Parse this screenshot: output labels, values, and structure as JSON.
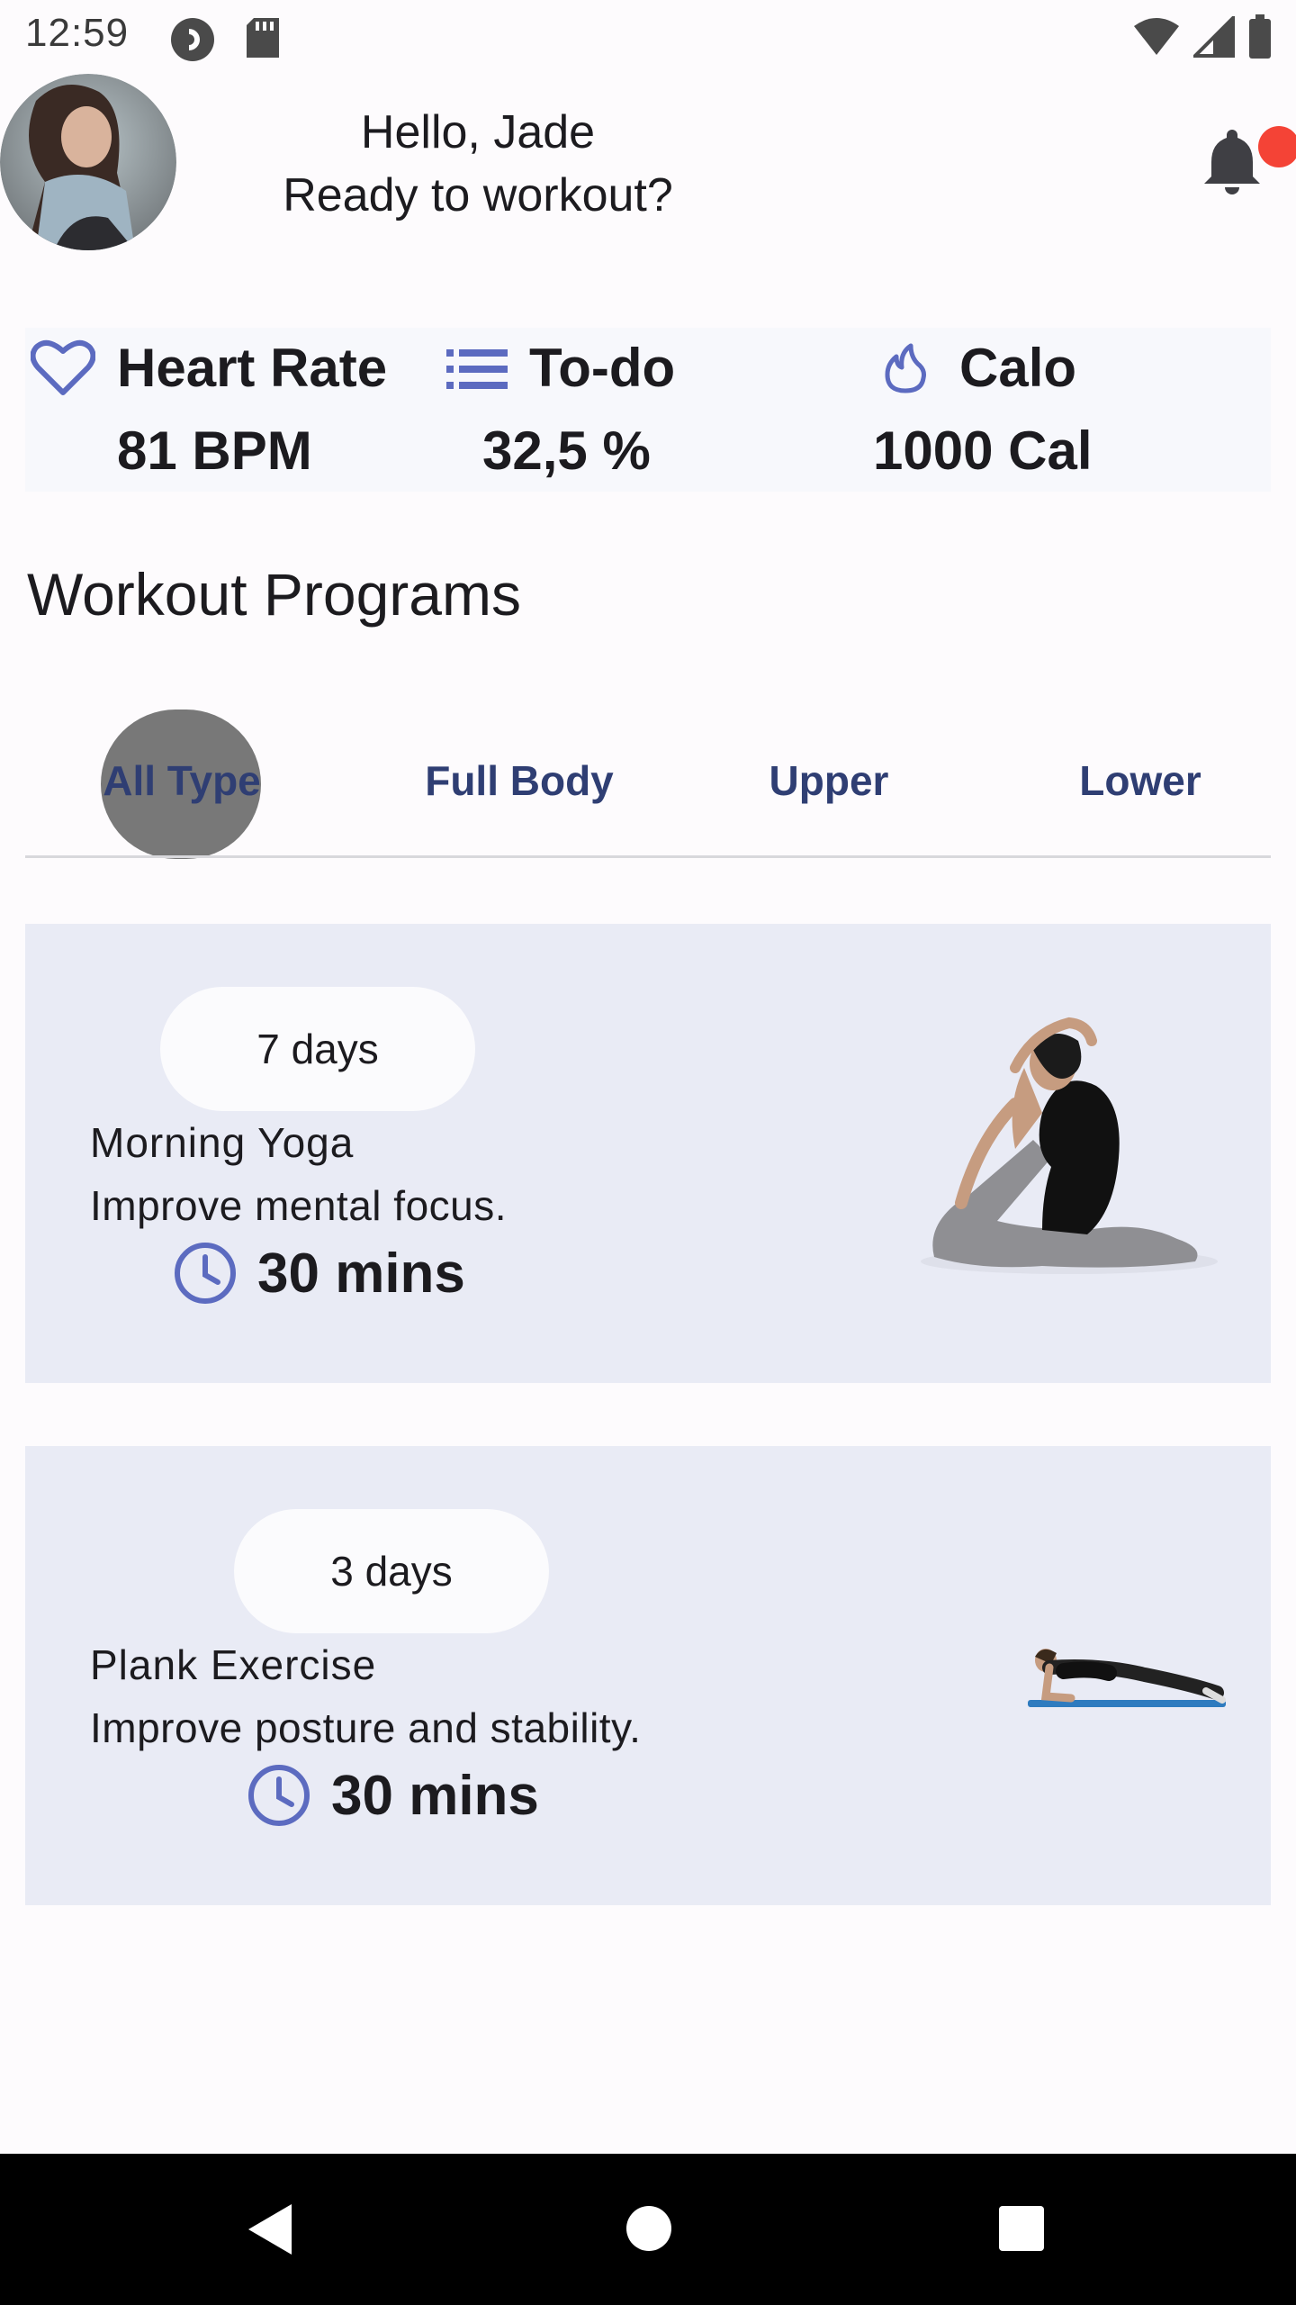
{
  "status_bar": {
    "time": "12:59",
    "left_icons": [
      "pocket-casts-icon",
      "sd-card-icon"
    ],
    "right_icons": [
      "wifi-icon",
      "signal-icon",
      "battery-icon"
    ]
  },
  "header": {
    "greeting": "Hello, Jade",
    "subtitle": "Ready to workout?",
    "avatar_icon": "avatar",
    "bell_icon": "bell-icon",
    "notification_color": "#f44336"
  },
  "stats": [
    {
      "icon": "heart-icon",
      "label": "Heart Rate",
      "value": "81 BPM"
    },
    {
      "icon": "list-icon",
      "label": "To-do",
      "value": "32,5 %"
    },
    {
      "icon": "flame-icon",
      "label": "Calo",
      "value": "1000 Cal"
    }
  ],
  "section_title": "Workout Programs",
  "tabs": [
    {
      "label": "All Type",
      "selected": true
    },
    {
      "label": "Full Body",
      "selected": false
    },
    {
      "label": "Upper",
      "selected": false
    },
    {
      "label": "Lower",
      "selected": false
    }
  ],
  "programs": [
    {
      "days": "7 days",
      "title": "Morning Yoga",
      "subtitle": "Improve mental focus.",
      "duration": "30 mins",
      "image": "yoga-illustration"
    },
    {
      "days": "3 days",
      "title": "Plank Exercise",
      "subtitle": "Improve posture and stability.",
      "duration": "30 mins",
      "image": "plank-illustration"
    }
  ],
  "nav": [
    "back-icon",
    "home-icon",
    "recents-icon"
  ],
  "colors": {
    "accent": "#5c6bc0",
    "tab_text": "#2f3e73",
    "card_bg": "#e9ebf5",
    "stats_bg": "#f7f8fc"
  }
}
